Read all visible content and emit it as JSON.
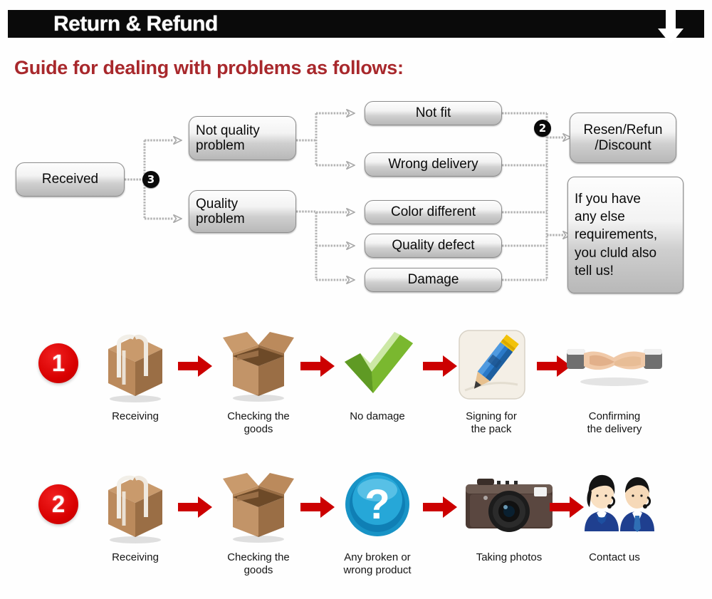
{
  "header": {
    "title": "Return & Refund",
    "arrow_icon": "down-arrow-icon",
    "bar_color": "#0a0a0a",
    "title_color": "#ffffff"
  },
  "guide": {
    "heading": "Guide for dealing with problems as follows:",
    "heading_color": "#a8282c"
  },
  "flowchart": {
    "badges": [
      {
        "id": "badge-3",
        "label": "③",
        "text": "3"
      },
      {
        "id": "badge-2",
        "label": "②",
        "text": "2"
      }
    ],
    "nodes": {
      "received": "Received",
      "not_quality_problem": "Not quality\nproblem",
      "quality_problem": "Quality\nproblem",
      "not_fit": "Not fit",
      "wrong_delivery": "Wrong delivery",
      "color_different": "Color different",
      "quality_defect": "Quality defect",
      "damage": "Damage",
      "resend_refund": "Resen/Refun\n/Discount",
      "else_requirements": "If you have any else requirements, you cluld also tell us!"
    },
    "node_lines": {
      "not_quality_problem": [
        "Not quality",
        "problem"
      ],
      "quality_problem": [
        "Quality",
        "problem"
      ],
      "resend_refund": [
        "Resen/Refun",
        "/Discount"
      ],
      "else_requirements": [
        "If you have",
        "any else",
        "requirements,",
        "you cluld also",
        "tell us!"
      ]
    }
  },
  "process_rows": [
    {
      "number": "1",
      "number_color": "#d80000",
      "steps": [
        {
          "icon": "sealed-box-icon",
          "caption": "Receiving"
        },
        {
          "icon": "open-box-icon",
          "caption": "Checking the goods",
          "caption_lines": [
            "Checking the",
            "goods"
          ]
        },
        {
          "icon": "green-check-icon",
          "caption": "No damage",
          "caption_lines": [
            "No damage"
          ]
        },
        {
          "icon": "pencil-signing-icon",
          "caption": "Signing for the pack",
          "caption_lines": [
            "Signing for",
            "the pack"
          ]
        },
        {
          "icon": "handshake-icon",
          "caption": "Confirming the delivery",
          "caption_lines": [
            "Confirming",
            "the delivery"
          ]
        }
      ]
    },
    {
      "number": "2",
      "number_color": "#d80000",
      "steps": [
        {
          "icon": "sealed-box-icon",
          "caption": "Receiving",
          "caption_lines": [
            "Receiving"
          ]
        },
        {
          "icon": "open-box-icon",
          "caption": "Checking the goods",
          "caption_lines": [
            "Checking the",
            "goods"
          ]
        },
        {
          "icon": "question-mark-icon",
          "caption": "Any broken or wrong product",
          "caption_lines": [
            "Any broken or",
            "wrong product"
          ]
        },
        {
          "icon": "camera-icon",
          "caption": "Taking photos",
          "caption_lines": [
            "Taking photos"
          ]
        },
        {
          "icon": "support-agents-icon",
          "caption": "Contact us",
          "caption_lines": [
            "Contact us"
          ]
        }
      ]
    }
  ],
  "colors": {
    "red_arrow": "#cc0000",
    "accent_red": "#d80000",
    "heading_red": "#a8282c",
    "box_border": "#8e8e8e"
  }
}
